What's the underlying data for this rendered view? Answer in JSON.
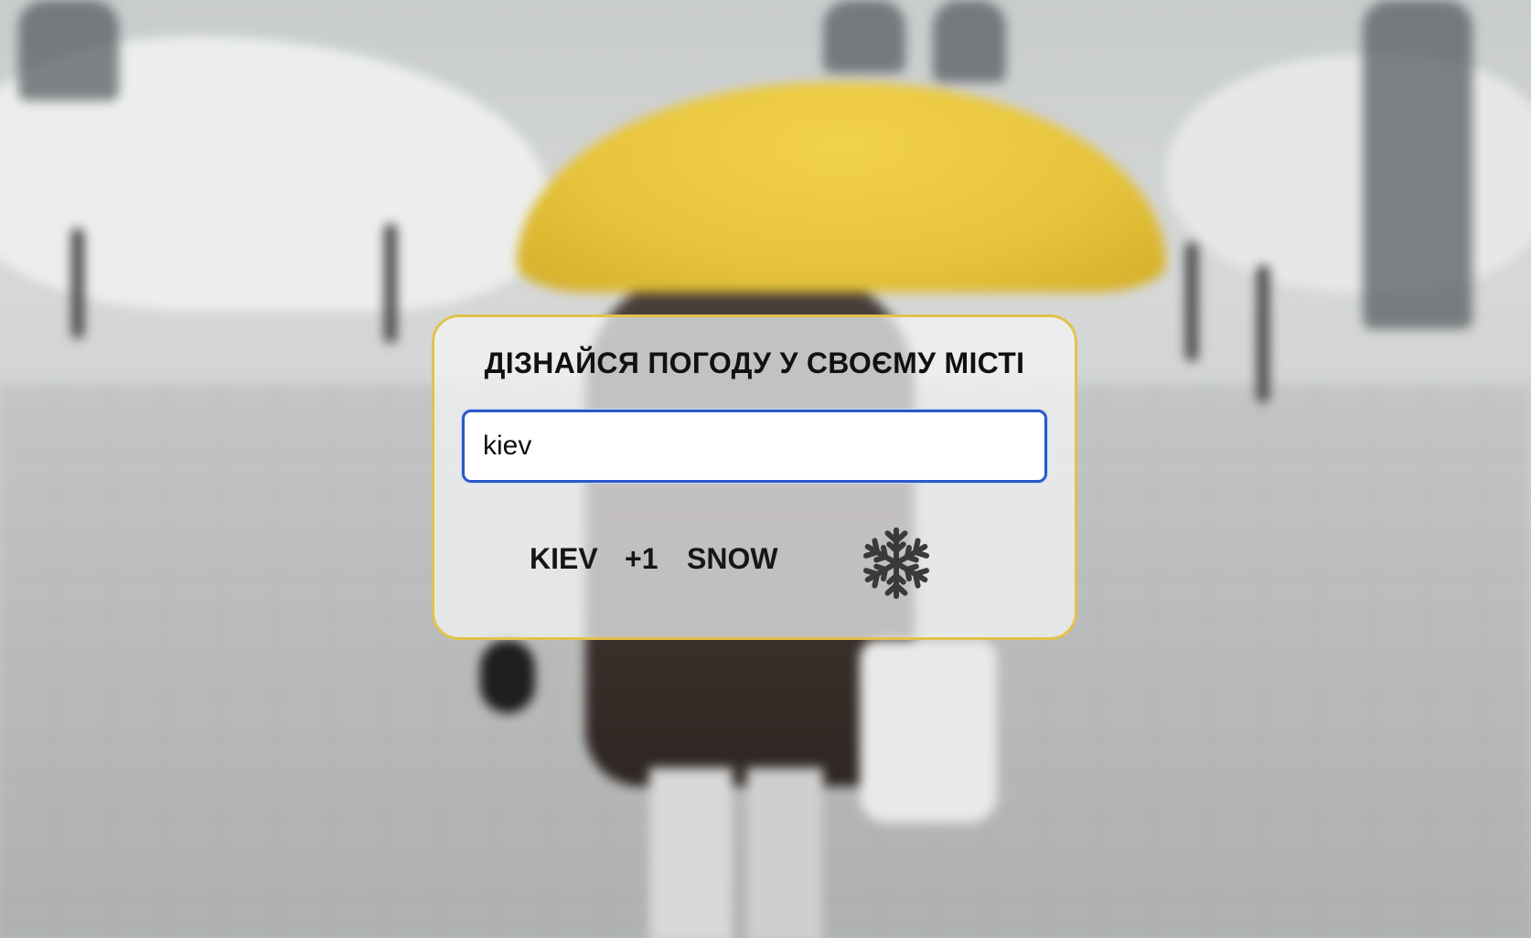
{
  "weather": {
    "title": "ДІЗНАЙСЯ ПОГОДУ У СВОЄМУ МІСТІ",
    "search": {
      "value": "kiev"
    },
    "result": {
      "city": "KIEV",
      "temperature": "+1",
      "description": "SNOW",
      "icon": "snowflake-icon"
    }
  },
  "colors": {
    "card_border": "#e3c24a",
    "input_border": "#2a59c7",
    "umbrella": "#e6c33a"
  }
}
